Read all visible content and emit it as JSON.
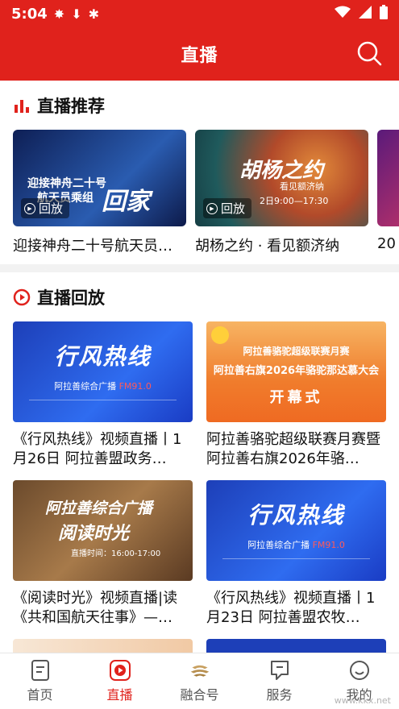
{
  "status_bar": {
    "time": "5:04"
  },
  "header": {
    "title": "直播"
  },
  "live_section": {
    "title": "直播推荐",
    "cards": [
      {
        "caption": "迎接神舟二十号航天员…",
        "badge": "回放",
        "thumb_text_1": "迎接神舟二十号",
        "thumb_text_2": "航天员乘组",
        "thumb_text_3": "回家"
      },
      {
        "caption": "胡杨之约 · 看见额济纳",
        "badge": "回放",
        "thumb_text_1": "胡杨之约",
        "thumb_text_2": "看见额济纳",
        "thumb_text_3": "2日9:00—17:30"
      }
    ],
    "peek_caption": "20"
  },
  "replay_section": {
    "title": "直播回放",
    "cards": [
      {
        "caption": "《行风热线》视频直播丨1月26日  阿拉善盟政务…",
        "thumb": "blue",
        "big": "行风热线",
        "sub": "阿拉善综合广播",
        "freq": "FM91.0"
      },
      {
        "caption": "阿拉善骆驼超级联赛月赛暨阿拉善右旗2026年骆…",
        "thumb": "orange",
        "l1": "阿拉善骆驼超级联赛月赛",
        "l2": "阿拉善右旗2026年骆驼那达慕大会",
        "l3": "开幕式"
      },
      {
        "caption": "《阅读时光》视频直播|读《共和国航天往事》—…",
        "thumb": "brown",
        "t1": "阿拉善综合广播",
        "t2": "阅读时光",
        "t3": "直播时间：16:00-17:00"
      },
      {
        "caption": "《行风热线》视频直播丨1月23日  阿拉善盟农牧…",
        "thumb": "blue",
        "big": "行风热线",
        "sub": "阿拉善综合广播",
        "freq": "FM91.0"
      }
    ]
  },
  "tabbar": {
    "items": [
      {
        "label": "首页",
        "icon": "home-doc-icon"
      },
      {
        "label": "直播",
        "icon": "play-icon"
      },
      {
        "label": "融合号",
        "icon": "fusion-icon"
      },
      {
        "label": "服务",
        "icon": "service-icon"
      },
      {
        "label": "我的",
        "icon": "profile-icon"
      }
    ]
  },
  "watermark": {
    "text": "www.kkx.net"
  },
  "colors": {
    "brand_red": "#e0221c"
  }
}
